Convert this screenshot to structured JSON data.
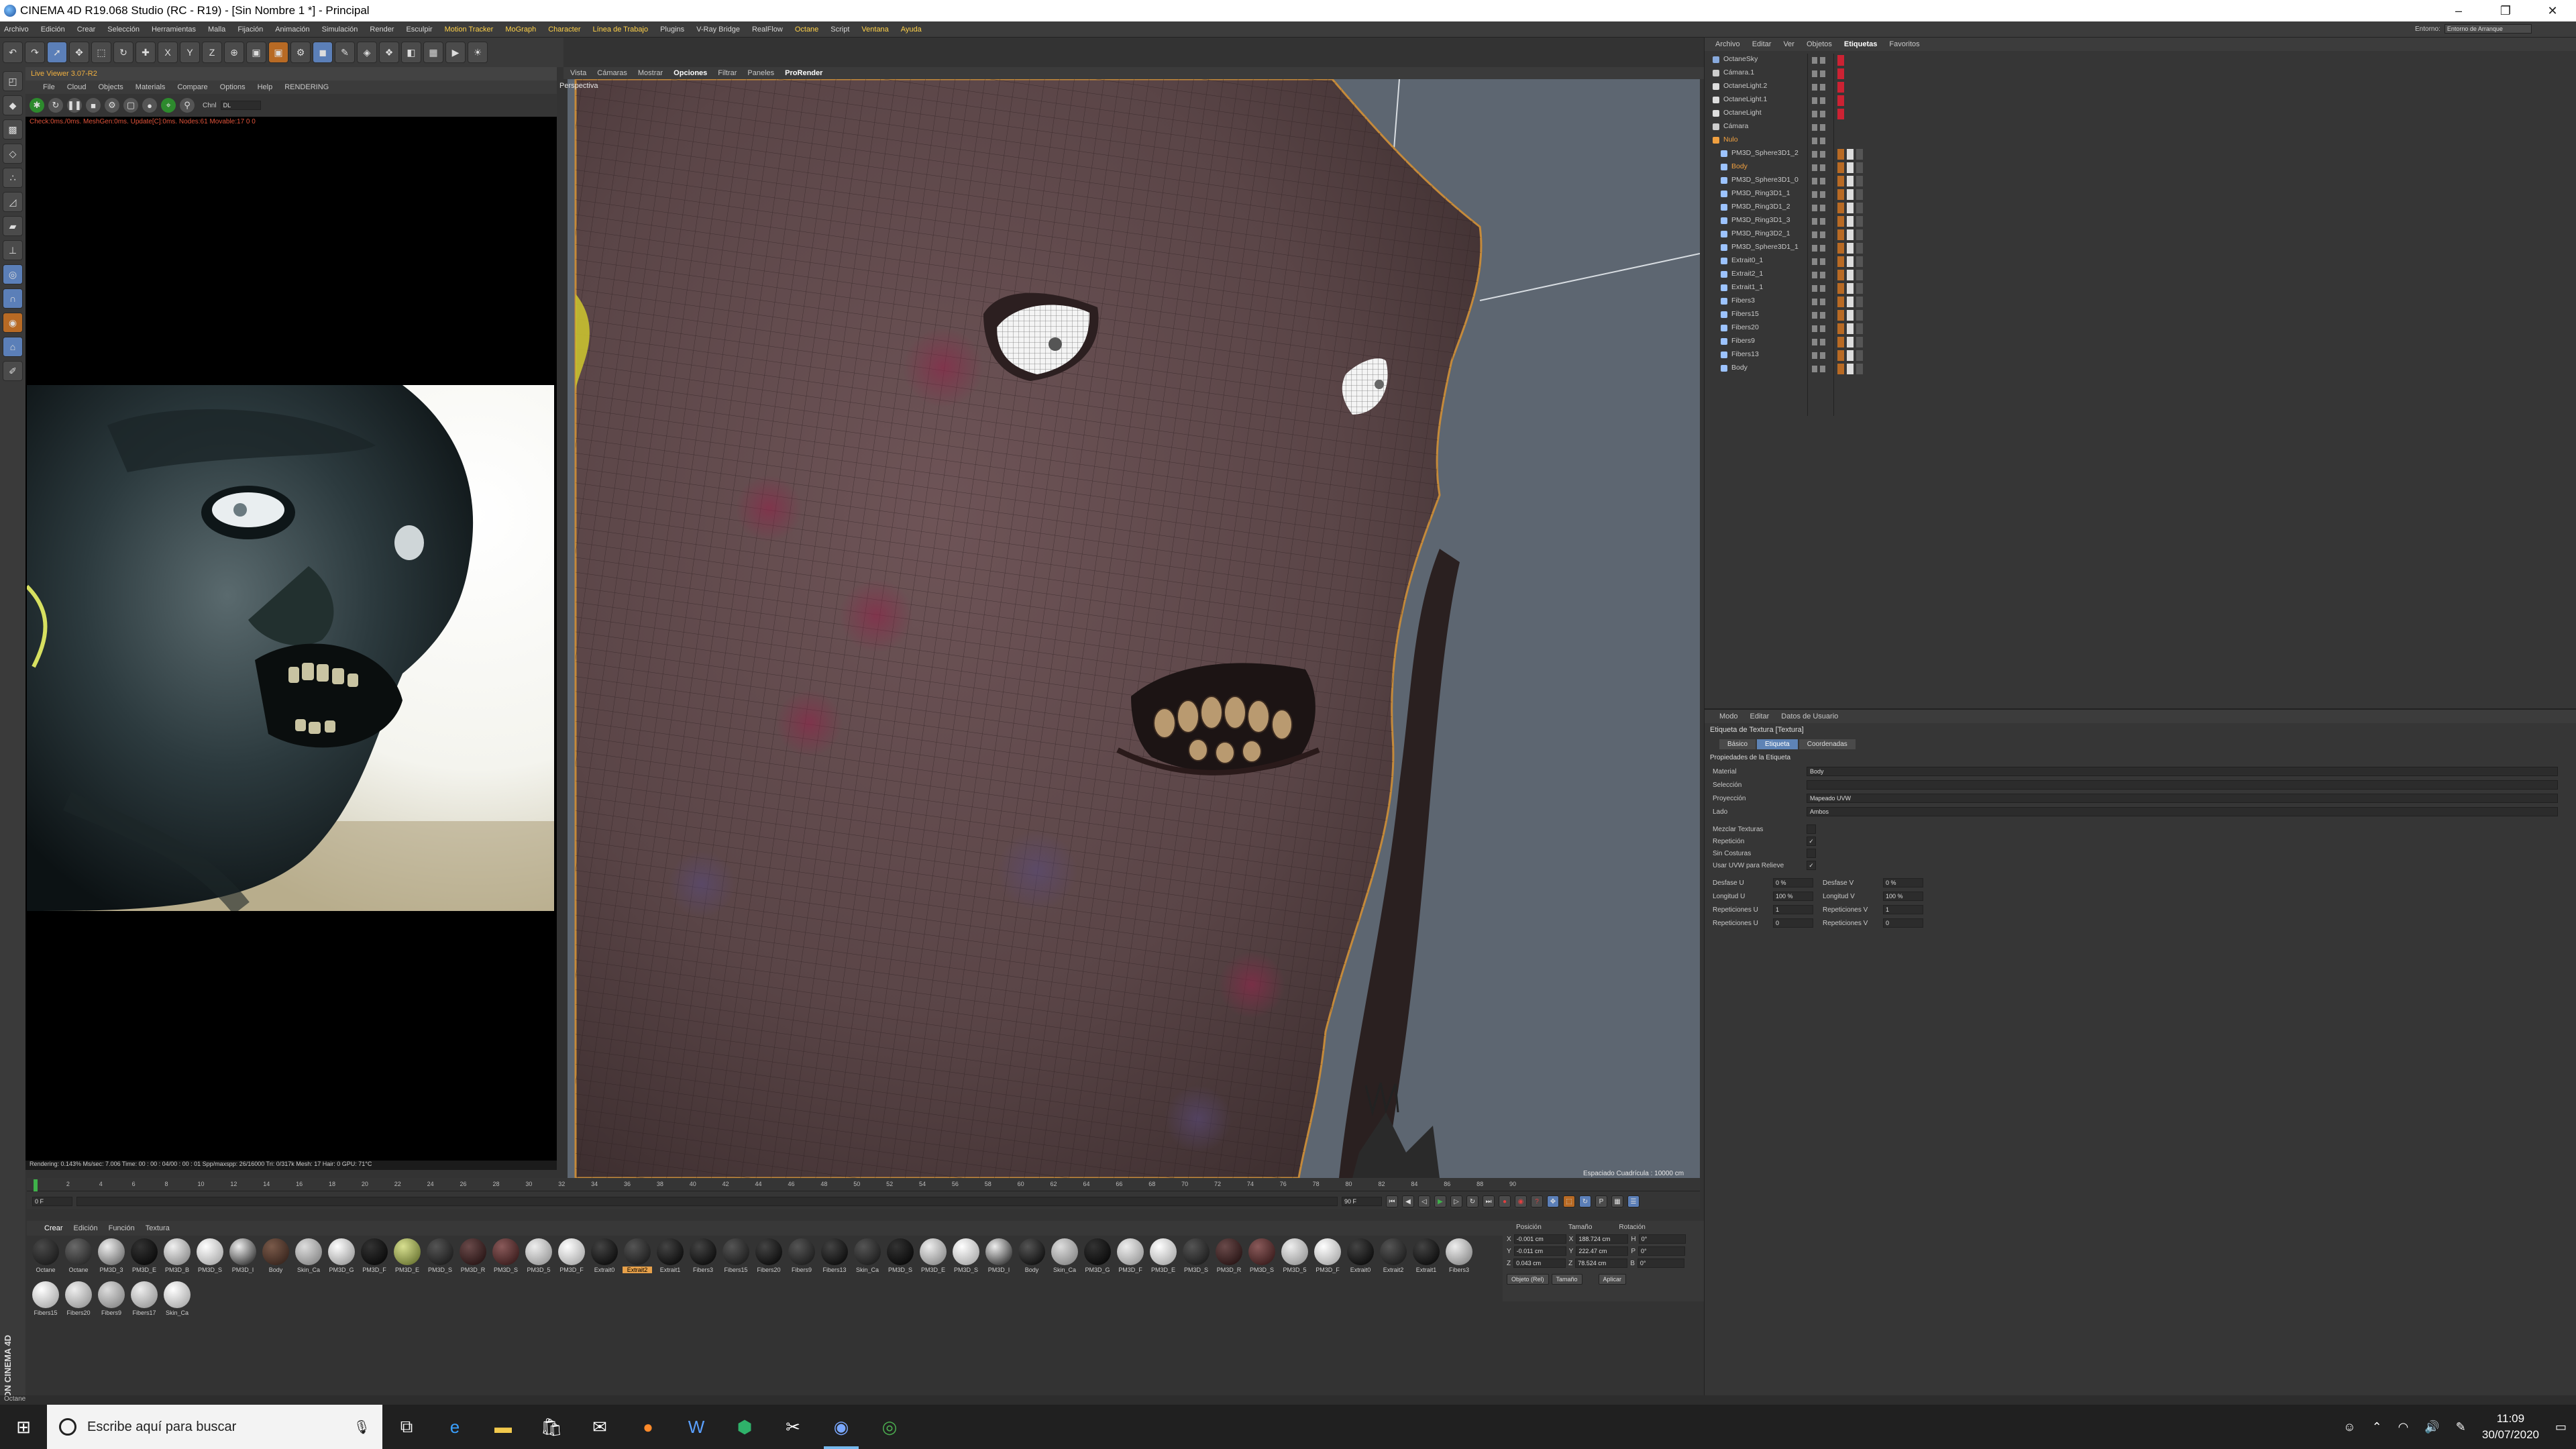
{
  "window": {
    "title": "CINEMA 4D R19.068 Studio (RC - R19) - [Sin Nombre 1 *] - Principal",
    "minimize": "–",
    "maximize": "❐",
    "close": "✕",
    "layout_label": "Entorno:",
    "layout_value": "Entorno de Arranque"
  },
  "menubar": [
    "Archivo",
    "Edición",
    "Crear",
    "Selección",
    "Herramientas",
    "Malla",
    "Fijación",
    "Animación",
    "Simulación",
    "Render",
    "Esculpir",
    "Motion Tracker",
    "MoGraph",
    "Character",
    "Línea de Trabajo",
    "Plugins",
    "V-Ray Bridge",
    "RealFlow",
    "Octane",
    "Script",
    "Ventana",
    "Ayuda"
  ],
  "toolbar": {
    "undo": "↶",
    "redo": "↷",
    "x": "X",
    "y": "Y",
    "z": "Z"
  },
  "octane": {
    "header": "Live Viewer 3.07-R2",
    "menu": [
      "File",
      "Cloud",
      "Objects",
      "Materials",
      "Compare",
      "Options",
      "Help",
      "RENDERING"
    ],
    "mode_label": "Chnl",
    "mode_value": "DL",
    "status": "Check:0ms./0ms. MeshGen:0ms. Update[C]:0ms. Nodes:61 Movable:17  0 0",
    "footer": "Rendering: 0.143%   Ms/sec: 7.006   Time: 00 : 00 : 04/00 : 00 : 01   Spp/maxspp: 26/16000   Tri: 0/317k   Mesh: 17   Hair: 0   GPU: 71°C"
  },
  "viewport": {
    "tabs": [
      "Vista",
      "Cámaras",
      "Mostrar",
      "Opciones",
      "Filtrar",
      "Paneles",
      "ProRender"
    ],
    "label": "Perspectiva",
    "grid_info": "Espaciado Cuadrícula : 10000 cm"
  },
  "timeline": {
    "ticks": [
      "0",
      "2",
      "4",
      "6",
      "8",
      "10",
      "12",
      "14",
      "16",
      "18",
      "20",
      "22",
      "24",
      "26",
      "28",
      "30",
      "32",
      "34",
      "36",
      "38",
      "40",
      "42",
      "44",
      "46",
      "48",
      "50",
      "52",
      "54",
      "56",
      "58",
      "60",
      "62",
      "64",
      "66",
      "68",
      "70",
      "72",
      "74",
      "76",
      "78",
      "80",
      "82",
      "84",
      "86",
      "88",
      "90"
    ],
    "start": "0 F",
    "end": "90 F",
    "current": "0 F",
    "frame_field": "0 F"
  },
  "materials": {
    "menu": [
      "Crear",
      "Edición",
      "Función",
      "Textura"
    ],
    "items": [
      {
        "name": "Octane",
        "c1": "#4a4a4a",
        "c2": "#111"
      },
      {
        "name": "Octane",
        "c1": "#6a6a6a",
        "c2": "#1a1a1a"
      },
      {
        "name": "PM3D_3",
        "c1": "#eeeeee",
        "c2": "#555"
      },
      {
        "name": "PM3D_E",
        "c1": "#333",
        "c2": "#000"
      },
      {
        "name": "PM3D_B",
        "c1": "#f0f0f0",
        "c2": "#777"
      },
      {
        "name": "PM3D_S",
        "c1": "#ffffff",
        "c2": "#999"
      },
      {
        "name": "PM3D_I",
        "c1": "#eeeeee",
        "c2": "#111"
      },
      {
        "name": "Body",
        "c1": "#7a5a4a",
        "c2": "#2a1a14"
      },
      {
        "name": "Skin_Ca",
        "c1": "#dddddd",
        "c2": "#777"
      },
      {
        "name": "PM3D_G",
        "c1": "#ffffff",
        "c2": "#888"
      },
      {
        "name": "PM3D_F",
        "c1": "#333",
        "c2": "#000"
      },
      {
        "name": "PM3D_E",
        "c1": "#d8e090",
        "c2": "#556020"
      },
      {
        "name": "PM3D_S",
        "c1": "#555",
        "c2": "#111"
      },
      {
        "name": "PM3D_R",
        "c1": "#6a4a4a",
        "c2": "#1a0a0a"
      },
      {
        "name": "PM3D_S",
        "c1": "#8a5a5a",
        "c2": "#2a1010"
      },
      {
        "name": "PM3D_5",
        "c1": "#eeeeee",
        "c2": "#888"
      },
      {
        "name": "PM3D_F",
        "c1": "#ffffff",
        "c2": "#999"
      },
      {
        "name": "Extrait0",
        "c1": "#444",
        "c2": "#000"
      },
      {
        "name": "Extrait2",
        "c1": "#555",
        "c2": "#111"
      },
      {
        "name": "Extrait1",
        "c1": "#444",
        "c2": "#000"
      },
      {
        "name": "Fibers3",
        "c1": "#444",
        "c2": "#000"
      },
      {
        "name": "Fibers15",
        "c1": "#555",
        "c2": "#111"
      },
      {
        "name": "Fibers20",
        "c1": "#444",
        "c2": "#000"
      },
      {
        "name": "Fibers9",
        "c1": "#555",
        "c2": "#111"
      },
      {
        "name": "Fibers13",
        "c1": "#444",
        "c2": "#000"
      },
      {
        "name": "Skin_Ca",
        "c1": "#555",
        "c2": "#111"
      },
      {
        "name": "PM3D_S",
        "c1": "#333",
        "c2": "#000"
      },
      {
        "name": "PM3D_E",
        "c1": "#eeeeee",
        "c2": "#777"
      },
      {
        "name": "PM3D_S",
        "c1": "#ffffff",
        "c2": "#999"
      },
      {
        "name": "PM3D_I",
        "c1": "#eeeeee",
        "c2": "#111"
      },
      {
        "name": "Body",
        "c1": "#555",
        "c2": "#000"
      },
      {
        "name": "Skin_Ca",
        "c1": "#dddddd",
        "c2": "#777"
      },
      {
        "name": "PM3D_G",
        "c1": "#333",
        "c2": "#000"
      },
      {
        "name": "PM3D_F",
        "c1": "#eeeeee",
        "c2": "#888"
      },
      {
        "name": "PM3D_E",
        "c1": "#ffffff",
        "c2": "#999"
      },
      {
        "name": "PM3D_S",
        "c1": "#555",
        "c2": "#111"
      },
      {
        "name": "PM3D_R",
        "c1": "#6a4a4a",
        "c2": "#1a0a0a"
      },
      {
        "name": "PM3D_S",
        "c1": "#8a5a5a",
        "c2": "#2a1010"
      },
      {
        "name": "PM3D_5",
        "c1": "#eeeeee",
        "c2": "#888"
      },
      {
        "name": "PM3D_F",
        "c1": "#ffffff",
        "c2": "#999"
      },
      {
        "name": "Extrait0",
        "c1": "#444",
        "c2": "#000"
      },
      {
        "name": "Extrait2",
        "c1": "#555",
        "c2": "#111"
      },
      {
        "name": "Extrait1",
        "c1": "#444",
        "c2": "#000"
      },
      {
        "name": "Fibers3",
        "c1": "#eeeeee",
        "c2": "#777"
      },
      {
        "name": "Fibers15",
        "c1": "#ffffff",
        "c2": "#999"
      },
      {
        "name": "Fibers20",
        "c1": "#eeeeee",
        "c2": "#888"
      },
      {
        "name": "Fibers9",
        "c1": "#dddddd",
        "c2": "#777"
      },
      {
        "name": "Fibers17",
        "c1": "#eeeeee",
        "c2": "#888"
      },
      {
        "name": "Skin_Ca",
        "c1": "#ffffff",
        "c2": "#999"
      }
    ],
    "selected_index": 18
  },
  "coords": {
    "headers": [
      "Posición",
      "Tamaño",
      "Rotación"
    ],
    "rows": [
      {
        "axis": "X",
        "pos": "-0.001 cm",
        "size": "188.724 cm",
        "rot_label": "H",
        "rot": "0°"
      },
      {
        "axis": "Y",
        "pos": "-0.011 cm",
        "size": "222.47 cm",
        "rot_label": "P",
        "rot": "0°"
      },
      {
        "axis": "Z",
        "pos": "0.043 cm",
        "size": "78.524 cm",
        "rot_label": "B",
        "rot": "0°"
      }
    ],
    "mode1": "Objeto (Rel)",
    "mode2": "Tamaño",
    "apply": "Aplicar"
  },
  "object_manager": {
    "tabs": [
      "Archivo",
      "Editar",
      "Ver",
      "Objetos",
      "Etiquetas",
      "Favoritos"
    ],
    "rows": [
      {
        "name": "OctaneSky",
        "indent": 0,
        "color": "#88aadd",
        "selected": false
      },
      {
        "name": "Cámara.1",
        "indent": 0,
        "color": "#cccccc",
        "selected": false
      },
      {
        "name": "OctaneLight.2",
        "indent": 0,
        "color": "#dddddd",
        "selected": false
      },
      {
        "name": "OctaneLight.1",
        "indent": 0,
        "color": "#dddddd",
        "selected": false
      },
      {
        "name": "OctaneLight",
        "indent": 0,
        "color": "#dddddd",
        "selected": false
      },
      {
        "name": "Cámara",
        "indent": 0,
        "color": "#cccccc",
        "selected": false
      },
      {
        "name": "Nulo",
        "indent": 0,
        "color": "#f0a040",
        "selected": true
      },
      {
        "name": "PM3D_Sphere3D1_2",
        "indent": 1,
        "color": "#9cc3ff",
        "selected": false
      },
      {
        "name": "Body",
        "indent": 1,
        "color": "#9cc3ff",
        "selected": true
      },
      {
        "name": "PM3D_Sphere3D1_0",
        "indent": 1,
        "color": "#9cc3ff",
        "selected": false
      },
      {
        "name": "PM3D_Ring3D1_1",
        "indent": 1,
        "color": "#9cc3ff",
        "selected": false
      },
      {
        "name": "PM3D_Ring3D1_2",
        "indent": 1,
        "color": "#9cc3ff",
        "selected": false
      },
      {
        "name": "PM3D_Ring3D1_3",
        "indent": 1,
        "color": "#9cc3ff",
        "selected": false
      },
      {
        "name": "PM3D_Ring3D2_1",
        "indent": 1,
        "color": "#9cc3ff",
        "selected": false
      },
      {
        "name": "PM3D_Sphere3D1_1",
        "indent": 1,
        "color": "#9cc3ff",
        "selected": false
      },
      {
        "name": "Extrait0_1",
        "indent": 1,
        "color": "#9cc3ff",
        "selected": false
      },
      {
        "name": "Extrait2_1",
        "indent": 1,
        "color": "#9cc3ff",
        "selected": false
      },
      {
        "name": "Extrait1_1",
        "indent": 1,
        "color": "#9cc3ff",
        "selected": false
      },
      {
        "name": "Fibers3",
        "indent": 1,
        "color": "#9cc3ff",
        "selected": false
      },
      {
        "name": "Fibers15",
        "indent": 1,
        "color": "#9cc3ff",
        "selected": false
      },
      {
        "name": "Fibers20",
        "indent": 1,
        "color": "#9cc3ff",
        "selected": false
      },
      {
        "name": "Fibers9",
        "indent": 1,
        "color": "#9cc3ff",
        "selected": false
      },
      {
        "name": "Fibers13",
        "indent": 1,
        "color": "#9cc3ff",
        "selected": false
      },
      {
        "name": "Body",
        "indent": 1,
        "color": "#9cc3ff",
        "selected": false
      }
    ]
  },
  "attributes": {
    "tabs": [
      "Modo",
      "Editar",
      "Datos de Usuario"
    ],
    "title": "Etiqueta de Textura [Textura]",
    "subtabs": [
      "Básico",
      "Etiqueta",
      "Coordenadas"
    ],
    "selected_subtab": 1,
    "section": "Propiedades de la Etiqueta",
    "fields": [
      {
        "label": "Material",
        "value": "Body",
        "wide": true
      },
      {
        "label": "Selección",
        "value": "",
        "wide": true
      },
      {
        "label": "Proyección",
        "value": "Mapeado UVW",
        "wide": true
      },
      {
        "label": "Lado",
        "value": "Ambos",
        "wide": true
      }
    ],
    "checks": [
      {
        "label": "Mezclar Texturas",
        "value": ""
      },
      {
        "label": "Repetición",
        "value": "✓"
      },
      {
        "label": "Sin Costuras",
        "value": ""
      },
      {
        "label": "Usar UVW para Relieve",
        "value": "✓"
      }
    ],
    "pairs": [
      {
        "l1": "Desfase U",
        "v1": "0 %",
        "l2": "Desfase V",
        "v2": "0 %"
      },
      {
        "l1": "Longitud U",
        "v1": "100 %",
        "l2": "Longitud V",
        "v2": "100 %"
      },
      {
        "l1": "Repeticiones U",
        "v1": "1",
        "l2": "Repeticiones V",
        "v2": "1"
      },
      {
        "l1": "Repeticiones U",
        "v1": "0",
        "l2": "Repeticiones V",
        "v2": "0"
      }
    ]
  },
  "statusbar": "Octane",
  "maxon": "MAXON CINEMA 4D",
  "taskbar": {
    "search_placeholder": "Escribe aquí para buscar",
    "time": "11:09",
    "date": "30/07/2020"
  }
}
